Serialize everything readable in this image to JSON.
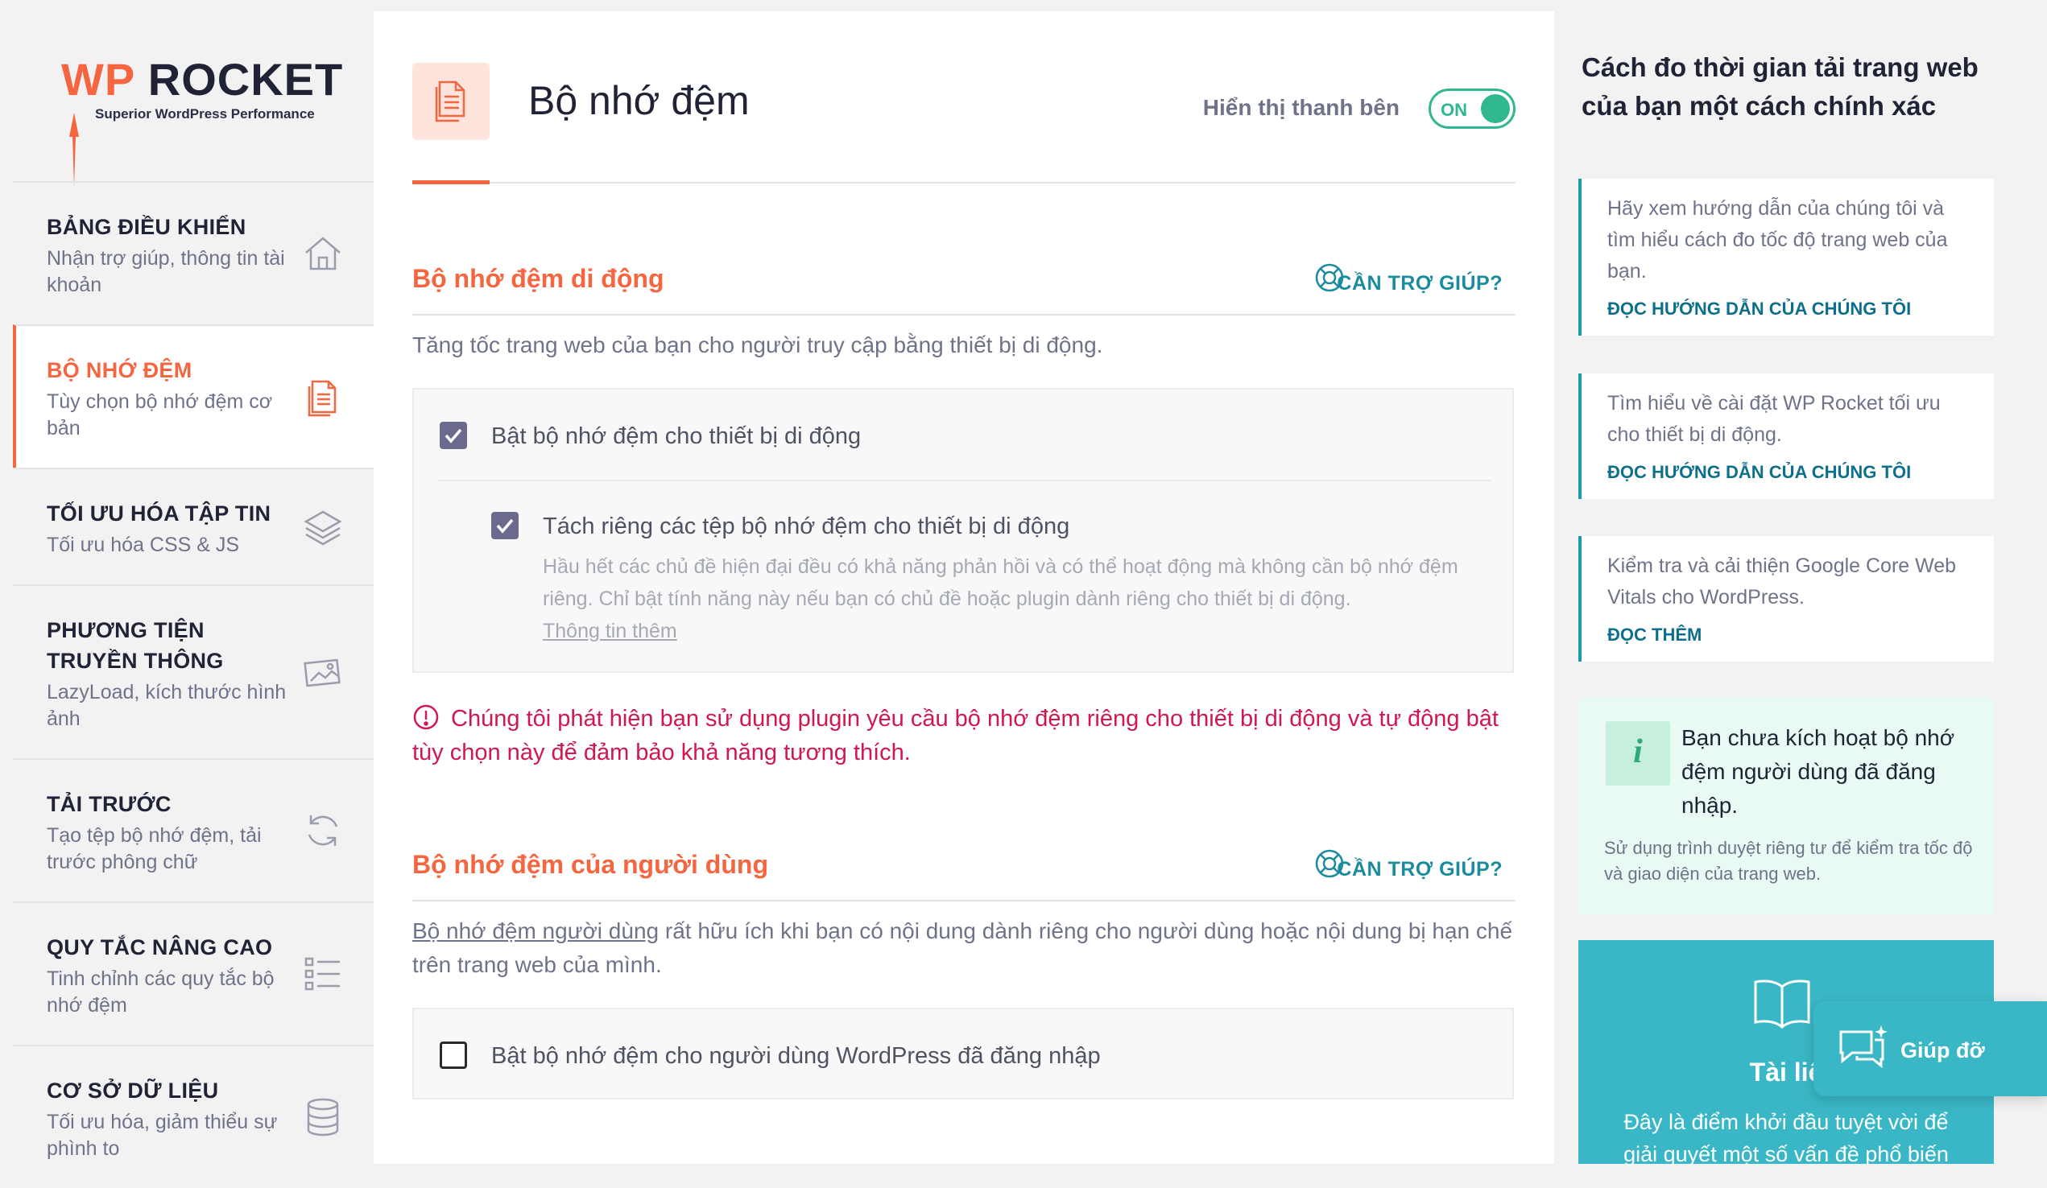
{
  "brand": {
    "wp": "WP",
    "name": "ROCKET",
    "tagline": "Superior WordPress Performance"
  },
  "nav": {
    "items": [
      {
        "title": "BẢNG ĐIỀU KHIỂN",
        "desc": "Nhận trợ giúp, thông tin tài khoản",
        "icon": "home-icon"
      },
      {
        "title": "BỘ NHỚ ĐỆM",
        "desc": "Tùy chọn bộ nhớ đệm cơ bản",
        "icon": "document-icon"
      },
      {
        "title": "TỐI ƯU HÓA TẬP TIN",
        "desc": "Tối ưu hóa CSS & JS",
        "icon": "layers-icon"
      },
      {
        "title": "PHƯƠNG TIỆN TRUYỀN THÔNG",
        "desc": "LazyLoad, kích thước hình ảnh",
        "icon": "image-icon"
      },
      {
        "title": "TẢI TRƯỚC",
        "desc": "Tạo tệp bộ nhớ đệm, tải trước phông chữ",
        "icon": "refresh-icon"
      },
      {
        "title": "QUY TẮC NÂNG CAO",
        "desc": "Tinh chỉnh các quy tắc bộ nhớ đệm",
        "icon": "list-icon"
      },
      {
        "title": "CƠ SỞ DỮ LIỆU",
        "desc": "Tối ưu hóa, giảm thiểu sự phình to",
        "icon": "database-icon"
      }
    ]
  },
  "header": {
    "title": "Bộ nhớ đệm",
    "sidebar_label": "Hiển thị thanh bên",
    "toggle_state": "ON"
  },
  "mobile": {
    "title": "Bộ nhớ đệm di động",
    "help": "CẦN TRỢ GIÚP?",
    "desc": "Tăng tốc trang web của bạn cho người truy cập bằng thiết bị di động.",
    "opt1_label": "Bật bộ nhớ đệm cho thiết bị di động",
    "opt1_checked": true,
    "opt2_label": "Tách riêng các tệp bộ nhớ đệm cho thiết bị di động",
    "opt2_checked": true,
    "opt2_desc": "Hầu hết các chủ đề hiện đại đều có khả năng phản hồi và có thể hoạt động mà không cần bộ nhớ đệm riêng. Chỉ bật tính năng này nếu bạn có chủ đề hoặc plugin dành riêng cho thiết bị di động.",
    "opt2_more": "Thông tin thêm",
    "warning": "Chúng tôi phát hiện bạn sử dụng plugin yêu cầu bộ nhớ đệm riêng cho thiết bị di động và tự động bật tùy chọn này để đảm bảo khả năng tương thích."
  },
  "user": {
    "title": "Bộ nhớ đệm của người dùng",
    "help": "CẦN TRỢ GIÚP?",
    "desc_link": "Bộ nhớ đệm người dùng",
    "desc_rest": " rất hữu ích khi bạn có nội dung dành riêng cho người dùng hoặc nội dung bị hạn chế trên trang web của mình.",
    "opt_label": "Bật bộ nhớ đệm cho người dùng WordPress đã đăng nhập",
    "opt_checked": false
  },
  "rpanel": {
    "title": "Cách đo thời gian tải trang web của bạn một cách chính xác",
    "cards": [
      {
        "text": "Hãy xem hướng dẫn của chúng tôi và tìm hiểu cách đo tốc độ trang web của bạn.",
        "link": "ĐỌC HƯỚNG DẪN CỦA CHÚNG TÔI"
      },
      {
        "text": "Tìm hiểu về cài đặt WP Rocket tối ưu cho thiết bị di động.",
        "link": "ĐỌC HƯỚNG DẪN CỦA CHÚNG TÔI"
      },
      {
        "text": "Kiểm tra và cải thiện Google Core Web Vitals cho WordPress.",
        "link": "ĐỌC THÊM"
      }
    ],
    "info_badge": "i",
    "info_title": "Bạn chưa kích hoạt bộ nhớ đệm người dùng đã đăng nhập.",
    "info_desc": "Sử dụng trình duyệt riêng tư để kiểm tra tốc độ và giao diện của trang web.",
    "doc_title": "Tài liệ",
    "doc_desc": "Đây là điểm khởi đầu tuyệt vời để giải quyết một số vấn đề phổ biến",
    "help_bubble": "Giúp đỡ"
  },
  "colors": {
    "accent": "#f56640",
    "teal": "#1a9aaa",
    "toggle_on": "#2fb890",
    "warning": "#d1174f",
    "checkbox": "#6a6a8e"
  }
}
